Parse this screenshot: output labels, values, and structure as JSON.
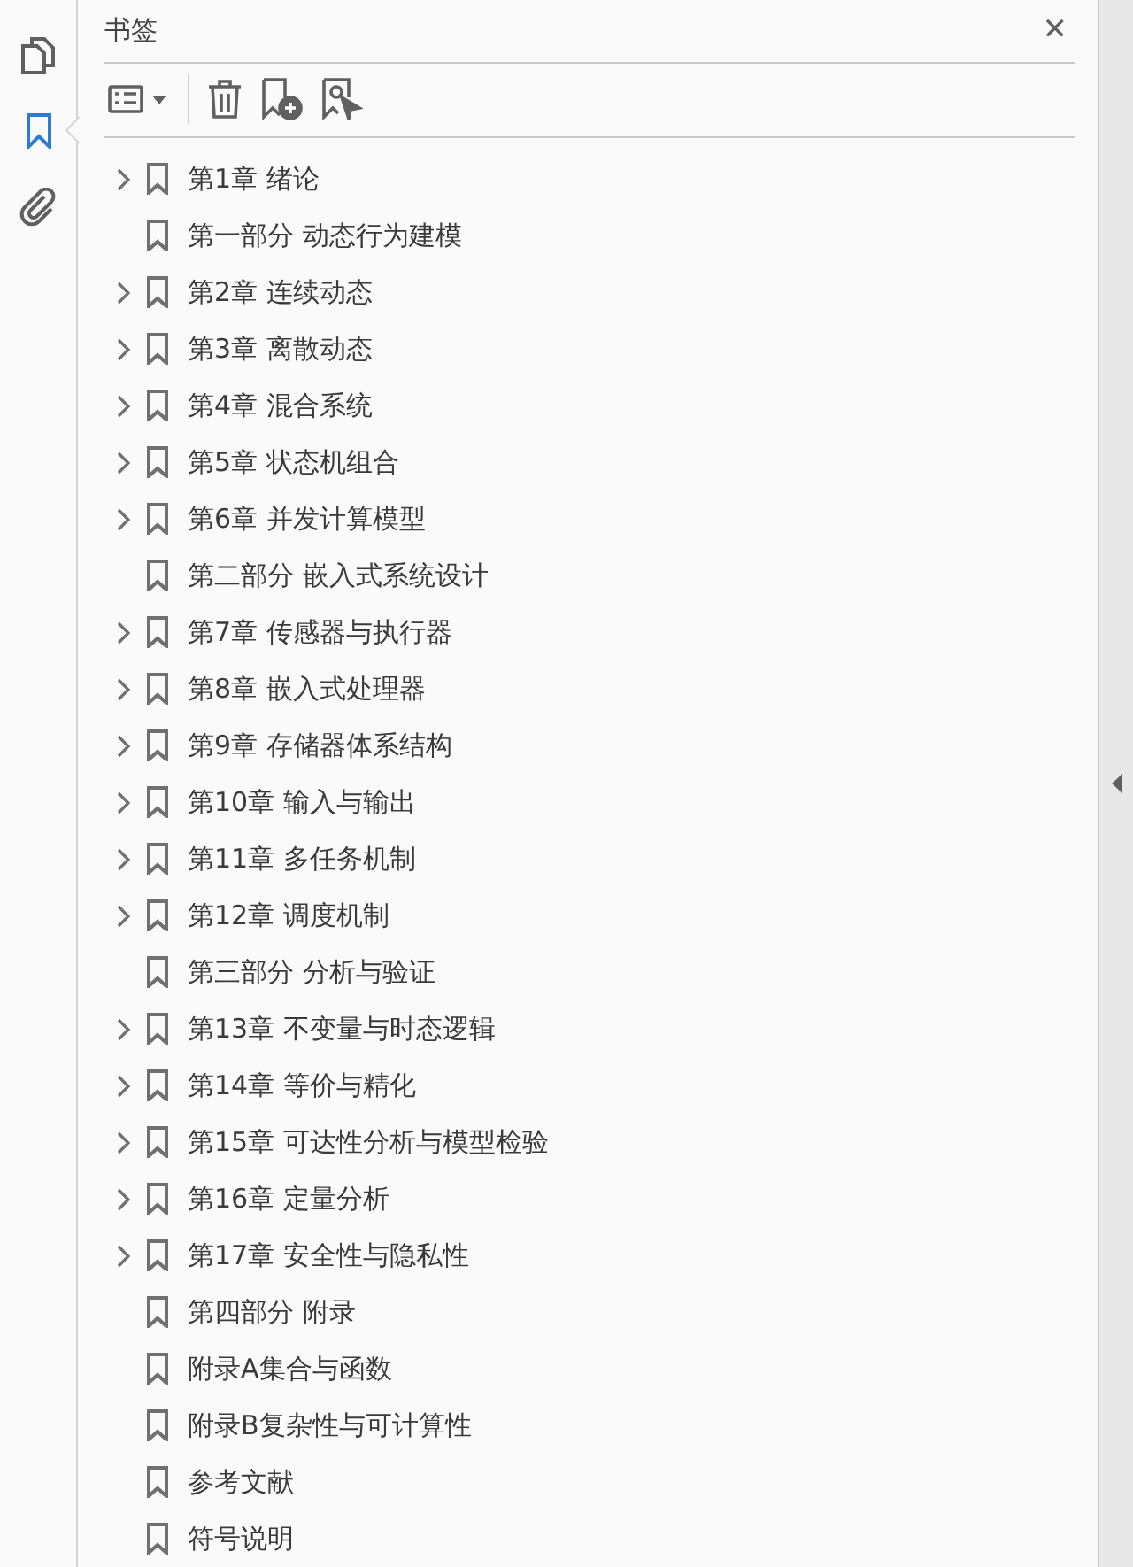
{
  "rail": [
    {
      "kind": "pages",
      "selected": false
    },
    {
      "kind": "bookmarks",
      "selected": true
    },
    {
      "kind": "attachments",
      "selected": false
    }
  ],
  "panel": {
    "title": "书签",
    "close": "✕"
  },
  "bookmarks": [
    {
      "label": "第1章 绪论",
      "expandable": true
    },
    {
      "label": "第一部分 动态行为建模",
      "expandable": false
    },
    {
      "label": "第2章 连续动态",
      "expandable": true
    },
    {
      "label": "第3章 离散动态",
      "expandable": true
    },
    {
      "label": "第4章 混合系统",
      "expandable": true
    },
    {
      "label": "第5章 状态机组合",
      "expandable": true
    },
    {
      "label": "第6章 并发计算模型",
      "expandable": true
    },
    {
      "label": "第二部分 嵌入式系统设计",
      "expandable": false
    },
    {
      "label": "第7章 传感器与执行器",
      "expandable": true
    },
    {
      "label": "第8章 嵌入式处理器",
      "expandable": true
    },
    {
      "label": "第9章 存储器体系结构",
      "expandable": true
    },
    {
      "label": "第10章 输入与输出",
      "expandable": true
    },
    {
      "label": "第11章 多任务机制",
      "expandable": true
    },
    {
      "label": "第12章 调度机制",
      "expandable": true
    },
    {
      "label": "第三部分 分析与验证",
      "expandable": false
    },
    {
      "label": "第13章 不变量与时态逻辑",
      "expandable": true
    },
    {
      "label": "第14章 等价与精化",
      "expandable": true
    },
    {
      "label": "第15章 可达性分析与模型检验",
      "expandable": true
    },
    {
      "label": "第16章 定量分析",
      "expandable": true
    },
    {
      "label": "第17章 安全性与隐私性",
      "expandable": true
    },
    {
      "label": "第四部分 附录",
      "expandable": false
    },
    {
      "label": "附录A集合与函数",
      "expandable": false
    },
    {
      "label": "附录B复杂性与可计算性",
      "expandable": false
    },
    {
      "label": "参考文献",
      "expandable": false
    },
    {
      "label": "符号说明",
      "expandable": false
    }
  ]
}
